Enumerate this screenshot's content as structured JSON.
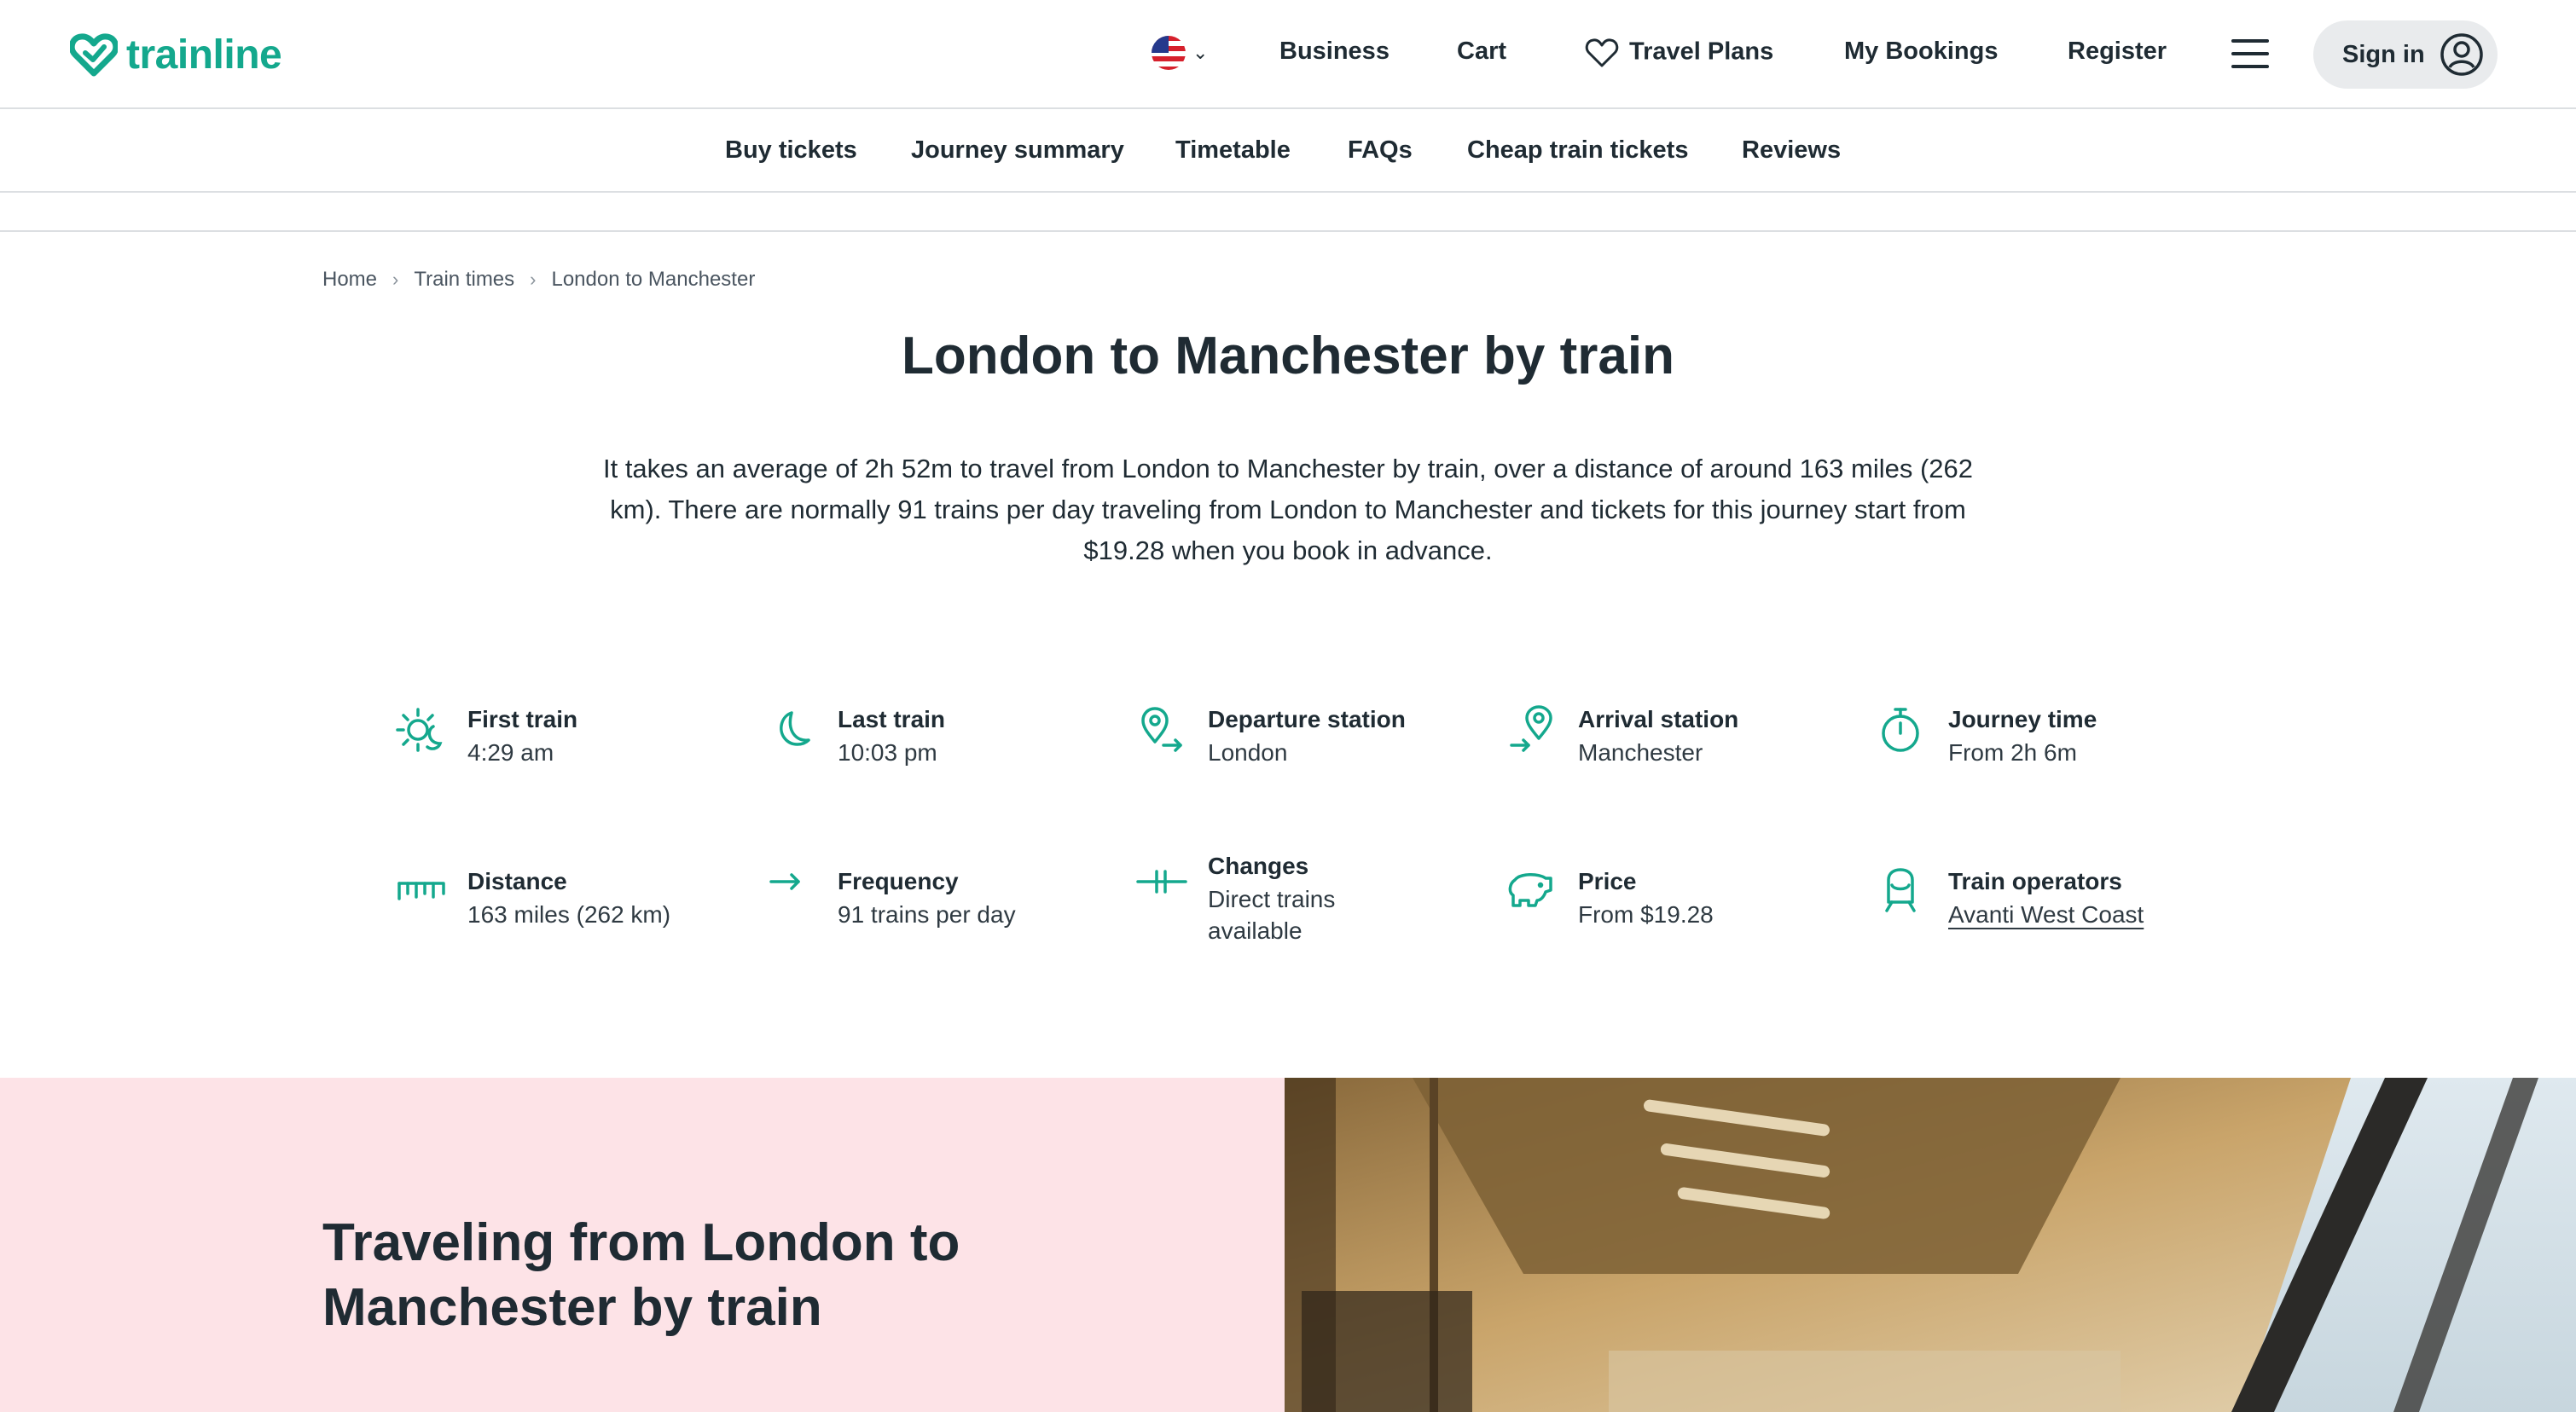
{
  "header": {
    "logo_text": "trainline",
    "nav": {
      "business": "Business",
      "cart": "Cart",
      "travel_plans": "Travel Plans",
      "my_bookings": "My Bookings",
      "register": "Register",
      "sign_in": "Sign in"
    }
  },
  "subnav": {
    "items": [
      "Buy tickets",
      "Journey summary",
      "Timetable",
      "FAQs",
      "Cheap train tickets",
      "Reviews"
    ]
  },
  "breadcrumb": [
    "Home",
    "Train times",
    "London to Manchester"
  ],
  "page": {
    "title": "London to Manchester by train",
    "intro": "It takes an average of 2h 52m to travel from London to Manchester by train, over a distance of around 163 miles (262 km). There are normally 91 trains per day traveling from London to Manchester and tickets for this journey start from $19.28 when you book in advance."
  },
  "facts": [
    {
      "icon": "sun-moon-icon",
      "label": "First train",
      "value": "4:29 am"
    },
    {
      "icon": "moon-icon",
      "label": "Last train",
      "value": "10:03 pm"
    },
    {
      "icon": "departure-pin-icon",
      "label": "Departure station",
      "value": "London"
    },
    {
      "icon": "arrival-pin-icon",
      "label": "Arrival station",
      "value": "Manchester"
    },
    {
      "icon": "stopwatch-icon",
      "label": "Journey time",
      "value": "From 2h 6m"
    },
    {
      "icon": "ruler-icon",
      "label": "Distance",
      "value": "163 miles (262 km)"
    },
    {
      "icon": "arrow-right-icon",
      "label": "Frequency",
      "value": "91 trains per day"
    },
    {
      "icon": "changes-icon",
      "label": "Changes",
      "value": "Direct trains available"
    },
    {
      "icon": "piggy-bank-icon",
      "label": "Price",
      "value": "From $19.28"
    },
    {
      "icon": "train-icon",
      "label": "Train operators",
      "value": "Avanti West Coast"
    }
  ],
  "section": {
    "title": "Traveling from London to Manchester by train"
  },
  "colors": {
    "brand": "#14a88d",
    "text": "#1f2b33",
    "pink_panel": "#fde3e7"
  }
}
